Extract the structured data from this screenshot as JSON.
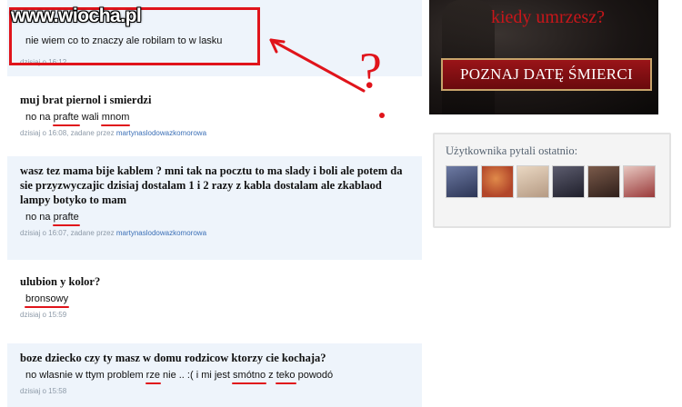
{
  "watermark": "www.wiocha.pl",
  "feed": {
    "items": [
      {
        "question": "",
        "answer": "nie wiem co to znaczy ale robilam to w lasku",
        "time": "dzisiaj o 16:12",
        "by_prefix": "",
        "by_user": ""
      },
      {
        "question": "muj brat piernol i smierdzi",
        "answer_parts": [
          "no na ",
          "prafte",
          " wali ",
          "mnom"
        ],
        "time": "dzisiaj o 16:08",
        "by_prefix": ", zadane przez ",
        "by_user": "martynaslodowazkomorowa"
      },
      {
        "question": "wasz tez mama bije kablem ? mni tak na pocztu to ma slady i boli ale potem da sie przyzwyczajic dzisiaj dostalam 1 i 2 razy z kabla dostalam ale zkablaod lampy botyko to mam",
        "answer_parts": [
          "no na ",
          "prafte"
        ],
        "time": "dzisiaj o 16:07",
        "by_prefix": ", zadane przez ",
        "by_user": "martynaslodowazkomorowa"
      },
      {
        "question": "ulubion y kolor?",
        "answer_parts": [
          "bronsowy"
        ],
        "time": "dzisiaj o 15:59"
      },
      {
        "question": "boze dziecko czy ty masz w domu rodzicow ktorzy cie kochaja?",
        "answer_parts": [
          "no wlasnie w ttym problem ",
          "rze",
          " nie .. :( i mi jest ",
          "smótno",
          " z ",
          "teko",
          " powodó"
        ],
        "time": "dzisiaj o 15:58"
      }
    ]
  },
  "ad": {
    "headline": "kiedy umrzesz?",
    "button": "POZNAJ DATĘ ŚMIERCI"
  },
  "recent_box": {
    "title": "Użytkownika pytali ostatnio:",
    "avatars": [
      "avatar-1",
      "avatar-2",
      "avatar-3",
      "avatar-4",
      "avatar-5",
      "avatar-6"
    ]
  },
  "annotation": {
    "symbol": "?"
  },
  "colors": {
    "highlight_red": "#e0141b",
    "tint": "#eef4fb",
    "meta_gray": "#8d9aa8",
    "link_blue": "#3b6fb6"
  }
}
